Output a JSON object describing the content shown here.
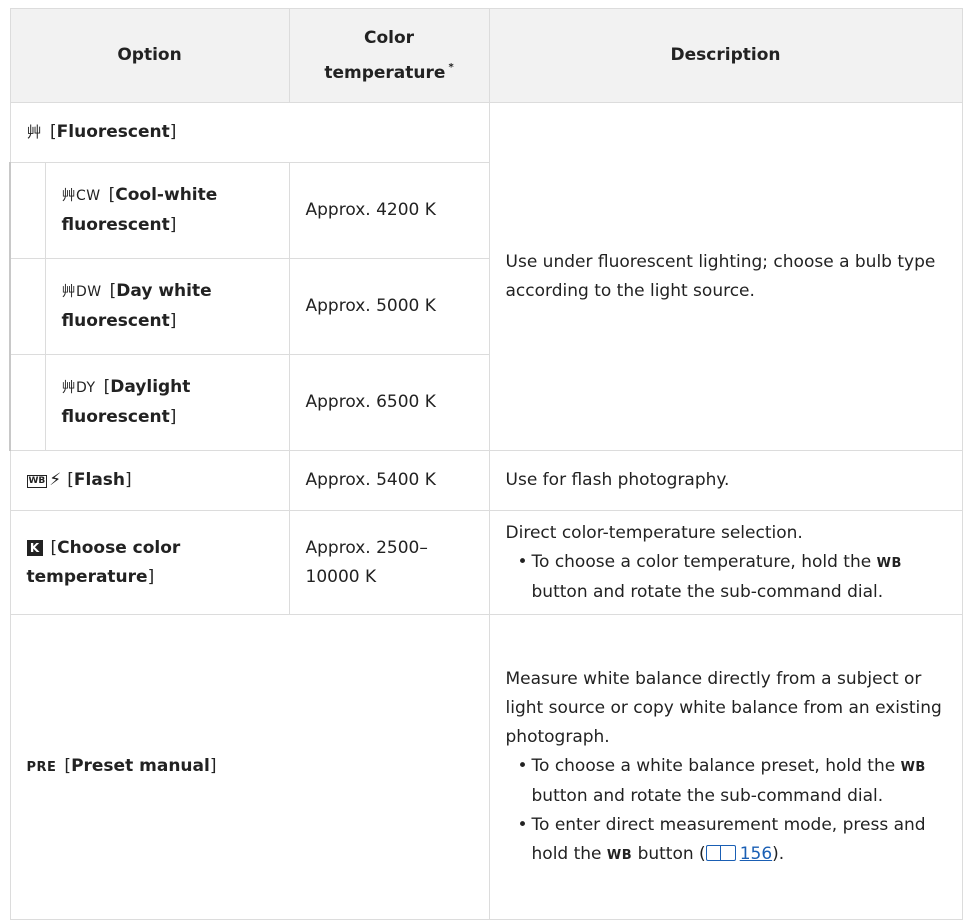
{
  "headers": {
    "option": "Option",
    "color_temp_l1": "Color",
    "color_temp_l2": "temperature",
    "color_temp_note": "*",
    "description": "Description"
  },
  "icons": {
    "fluorescent": "fluorescent-icon",
    "flash": "flash-wb-icon",
    "kelvin": "kelvin-icon",
    "preset": "preset-manual-icon",
    "manual_ref": "book-icon"
  },
  "rows": {
    "fluorescent": {
      "icon_text": "⾋",
      "label": "Fluorescent",
      "description": "Use under fluorescent lighting; choose a bulb type according to the light source.",
      "subs": [
        {
          "icon_text": "⾋CW",
          "label_l1": "Cool-white",
          "label_l2": "fluorescent",
          "temp": "Approx. 4200 K"
        },
        {
          "icon_text": "⾋DW",
          "label_l1": "Day white",
          "label_l2": "fluorescent",
          "temp": "Approx. 5000 K"
        },
        {
          "icon_text": "⾋DY",
          "label_l1": "Daylight",
          "label_l2": "fluorescent",
          "temp": "Approx. 6500 K"
        }
      ]
    },
    "flash": {
      "label": "Flash",
      "temp": "Approx. 5400 K",
      "description": "Use for flash photography."
    },
    "kelvin": {
      "label_l1": "Choose color",
      "label_l2": "temperature",
      "temp_l1": "Approx. 2500–",
      "temp_l2": "10000 K",
      "description": "Direct color-temperature selection.",
      "bullet_pre": "To choose a color temperature, hold the ",
      "bullet_btn": "WB",
      "bullet_post": " button and rotate the sub-command dial."
    },
    "preset": {
      "icon_text": "PRE",
      "label": "Preset manual",
      "description": "Measure white balance directly from a subject or light source or copy white balance from an existing photograph.",
      "bullet1_pre": "To choose a white balance preset, hold the ",
      "bullet1_btn": "WB",
      "bullet1_post": " button and rotate the sub-command dial.",
      "bullet2_pre": "To enter direct measurement mode, press and hold the ",
      "bullet2_btn": "WB",
      "bullet2_mid": " button (",
      "bullet2_page": "156",
      "bullet2_end": ")."
    }
  }
}
